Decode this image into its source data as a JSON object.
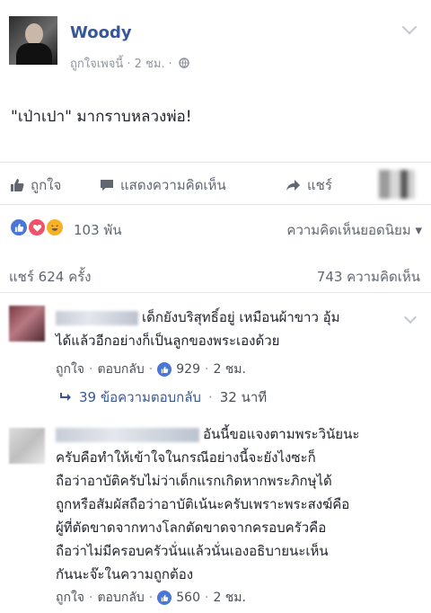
{
  "post": {
    "author": "Woody",
    "meta": "ถูกใจเพจนี้ · 2 ชม. ·",
    "text": "\"เป่าเปา\" มากราบหลวงพ่อ!"
  },
  "actions": {
    "like": "ถูกใจ",
    "comment": "แสดงความคิดเห็น",
    "share": "แชร์"
  },
  "reactions": {
    "count": "103 พัน",
    "top_comments": "ความคิดเห็นยอดนิยม ▾"
  },
  "stats": {
    "shares": "แชร์ 624 ครั้ง",
    "comments": "743 ความคิดเห็น"
  },
  "comments": [
    {
      "line1": "เด็กยังบริสุทธิ์อยู่ เหมือนผ้าขาว อุ้ม",
      "line2": "ได้แล้วอีกอย่างก็เป็นลูกของพระเองด้วย",
      "like": "ถูกใจ",
      "reply": "ตอบกลับ",
      "likes": "929",
      "time": "2 ชม.",
      "replies_text": "39 ข้อความตอบกลับ",
      "replies_time": "32 นาที"
    },
    {
      "line1": "อันนี้ขอแจงตามพระวินัยนะ",
      "line2": "ครับคือทำให้เข้าใจในกรณีอย่างนี้จะยังไงซะก็",
      "line3": "ถือว่าอาบัติครับไม่ว่าเด็กแรกเกิดหากพระภิกษุได้",
      "line4": "ถูกหรือสัมผัสถือว่าอาบัติเน้นะครับเพราะพระสงฆ์คือ",
      "line5": "ผู้ที่ตัดขาดจากทางโลกตัดขาดจากครอบครัวคือ",
      "line6": "ถือว่าไม่มีครอบครัวนั่นแล้วนั่นเองอธิบายนะเห็น",
      "line7": "กันนะจ๊ะในความถูกต้อง",
      "like": "ถูกใจ",
      "reply": "ตอบกลับ",
      "likes": "560",
      "time": "2 ชม."
    }
  ],
  "colors": {
    "link": "#365899",
    "like_blue": "#4a76d8",
    "muted": "#90949c"
  }
}
